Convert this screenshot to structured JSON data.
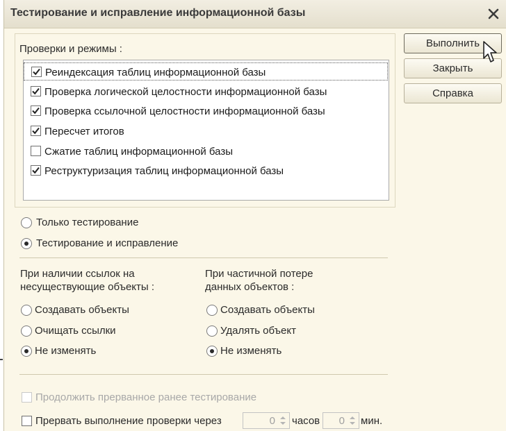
{
  "window": {
    "title": "Тестирование и исправление информационной базы"
  },
  "checks_group": {
    "label": "Проверки и режимы :",
    "items": [
      {
        "label": "Реиндексация таблиц информационной базы",
        "checked": true,
        "selected": true
      },
      {
        "label": "Проверка логической целостности информационной базы",
        "checked": true
      },
      {
        "label": "Проверка ссылочной целостности информационной базы",
        "checked": true
      },
      {
        "label": "Пересчет итогов",
        "checked": true
      },
      {
        "label": "Сжатие таблиц информационной базы",
        "checked": false
      },
      {
        "label": "Реструктуризация таблиц информационной базы",
        "checked": true
      }
    ]
  },
  "mode": {
    "options": [
      {
        "label": "Только тестирование",
        "selected": false
      },
      {
        "label": "Тестирование и исправление",
        "selected": true
      }
    ]
  },
  "missing_refs": {
    "label_line1": "При наличии ссылок на",
    "label_line2": "несуществующие объекты :",
    "options": [
      {
        "label": "Создавать объекты",
        "selected": false
      },
      {
        "label": "Очищать ссылки",
        "selected": false
      },
      {
        "label": "Не изменять",
        "selected": true
      }
    ]
  },
  "partial_loss": {
    "label_line1": "При частичной потере",
    "label_line2": "данных объектов :",
    "options": [
      {
        "label": "Создавать объекты",
        "selected": false
      },
      {
        "label": "Удалять объект",
        "selected": false
      },
      {
        "label": "Не изменять",
        "selected": true
      }
    ]
  },
  "continue_interrupted": {
    "label": "Продолжить прерванное ранее тестирование",
    "checked": false,
    "enabled": false
  },
  "interrupt_after": {
    "label": "Прервать выполнение проверки через",
    "checked": false,
    "hours_value": "0",
    "hours_label": "часов",
    "minutes_value": "0",
    "minutes_label": "мин."
  },
  "buttons": {
    "run": "Выполнить",
    "close": "Закрыть",
    "help": "Справка"
  },
  "colors": {
    "dialog_bg": "#fbf7e8",
    "disabled_text": "#a8a8a8"
  },
  "icons": {
    "close": "close-icon",
    "check": "checkmark-icon",
    "cursor": "mouse-pointer-icon"
  }
}
